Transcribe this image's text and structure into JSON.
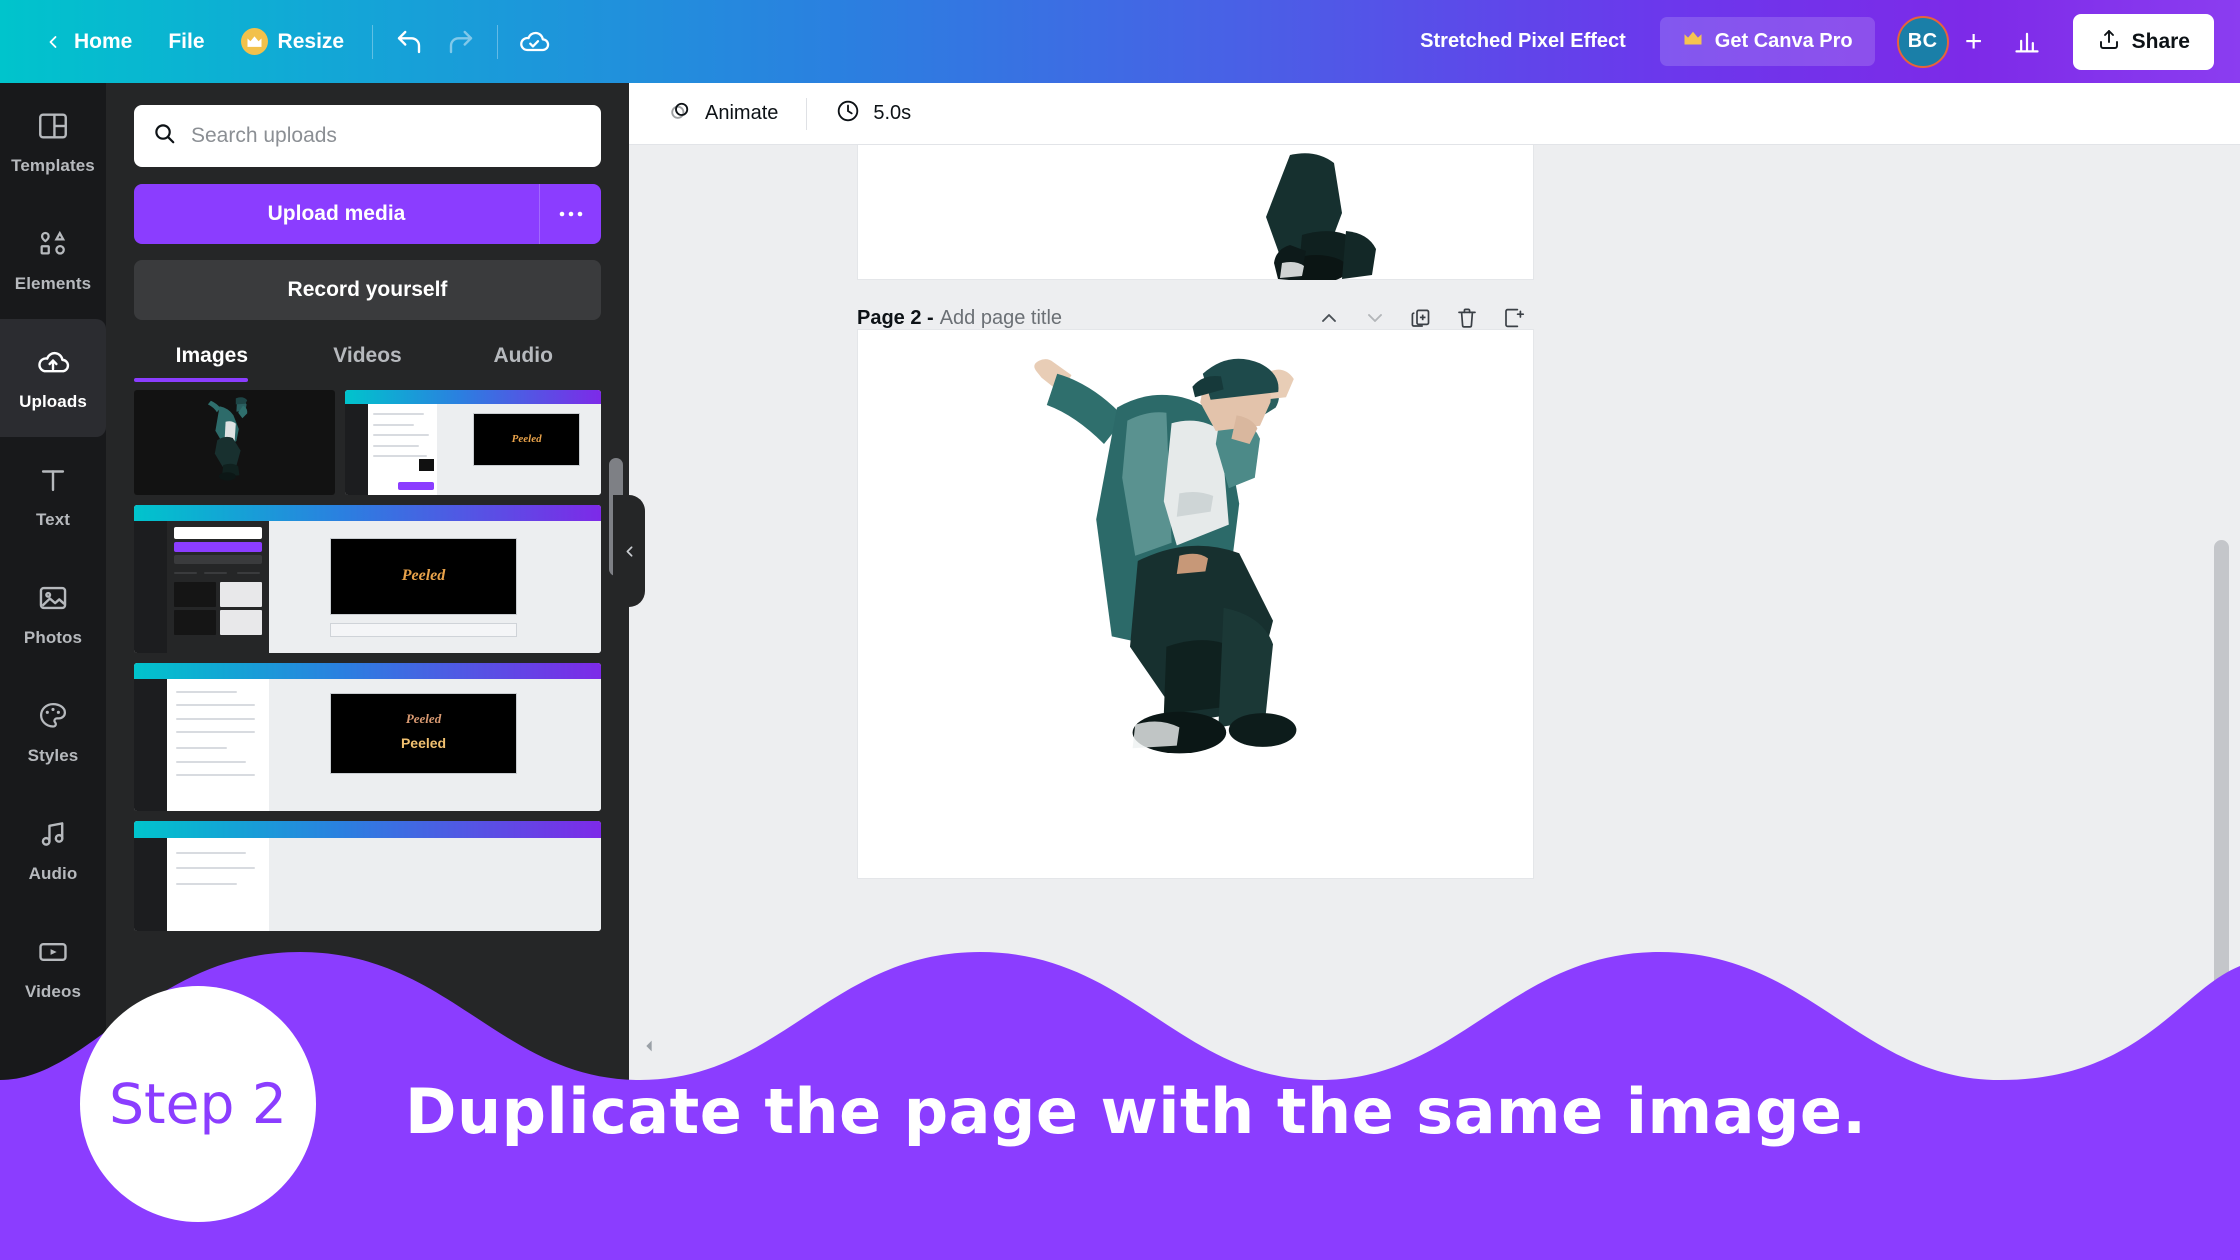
{
  "topbar": {
    "back_icon": "chevron-left-icon",
    "home_label": "Home",
    "file_label": "File",
    "resize_label": "Resize",
    "resize_badge_icon": "crown-icon",
    "undo_icon": "undo-icon",
    "redo_icon": "redo-icon",
    "cloud_icon": "cloud-saved-icon",
    "doc_title": "Stretched Pixel Effect",
    "pro_label": "Get Canva Pro",
    "pro_icon": "crown-icon",
    "avatar_initials": "BC",
    "add_member_label": "+",
    "insights_icon": "bar-chart-icon",
    "share_label": "Share",
    "share_icon": "share-upload-icon",
    "gradient_start": "#00c4cc",
    "gradient_mid": "#2b7fe0",
    "gradient_end": "#8b3df0"
  },
  "rail": {
    "items": [
      {
        "label": "Templates",
        "icon": "templates-icon",
        "active": false
      },
      {
        "label": "Elements",
        "icon": "elements-icon",
        "active": false
      },
      {
        "label": "Uploads",
        "icon": "cloud-upload-icon",
        "active": true
      },
      {
        "label": "Text",
        "icon": "text-icon",
        "active": false
      },
      {
        "label": "Photos",
        "icon": "photos-icon",
        "active": false
      },
      {
        "label": "Styles",
        "icon": "palette-icon",
        "active": false
      },
      {
        "label": "Audio",
        "icon": "music-note-icon",
        "active": false
      },
      {
        "label": "Videos",
        "icon": "video-icon",
        "active": false
      }
    ]
  },
  "panel": {
    "search_placeholder": "Search uploads",
    "search_icon": "search-icon",
    "upload_label": "Upload media",
    "more_label": "•••",
    "record_label": "Record yourself",
    "tabs": [
      {
        "label": "Images",
        "active": true
      },
      {
        "label": "Videos",
        "active": false
      },
      {
        "label": "Audio",
        "active": false
      }
    ],
    "collapse_icon": "chevron-left-icon",
    "accent_color": "#8b3dff"
  },
  "canvas_toolbar": {
    "animate_label": "Animate",
    "animate_icon": "animate-icon",
    "duration_label": "5.0s",
    "duration_icon": "clock-icon"
  },
  "page": {
    "title": "Page 2 -",
    "subtitle": "Add page title",
    "actions": [
      {
        "name": "move-page-up",
        "icon": "chevron-up-icon",
        "dim": false
      },
      {
        "name": "move-page-down",
        "icon": "chevron-down-icon",
        "dim": true
      },
      {
        "name": "duplicate-page",
        "icon": "duplicate-icon",
        "dim": false
      },
      {
        "name": "delete-page",
        "icon": "trash-icon",
        "dim": false
      },
      {
        "name": "add-page",
        "icon": "add-page-icon",
        "dim": false
      }
    ]
  },
  "annotation": {
    "arrow_direction": "left",
    "arrow_color": "#8b3dff"
  },
  "banner": {
    "step_label": "Step 2",
    "instruction": "Duplicate the page with the same image.",
    "background_color": "#8b3dff",
    "circle_color": "#ffffff"
  },
  "uploads": {
    "thumbnails": [
      {
        "name": "dancer-cutout-thumb",
        "type": "image"
      },
      {
        "name": "canva-editor-peeled-thumb",
        "type": "screenshot"
      },
      {
        "name": "canva-editor-peeled-wide-thumb",
        "type": "screenshot"
      },
      {
        "name": "canva-editor-peeled-text-thumb",
        "type": "screenshot"
      },
      {
        "name": "canva-editor-partial-thumb",
        "type": "screenshot"
      }
    ],
    "peeled_text": "Peeled"
  }
}
